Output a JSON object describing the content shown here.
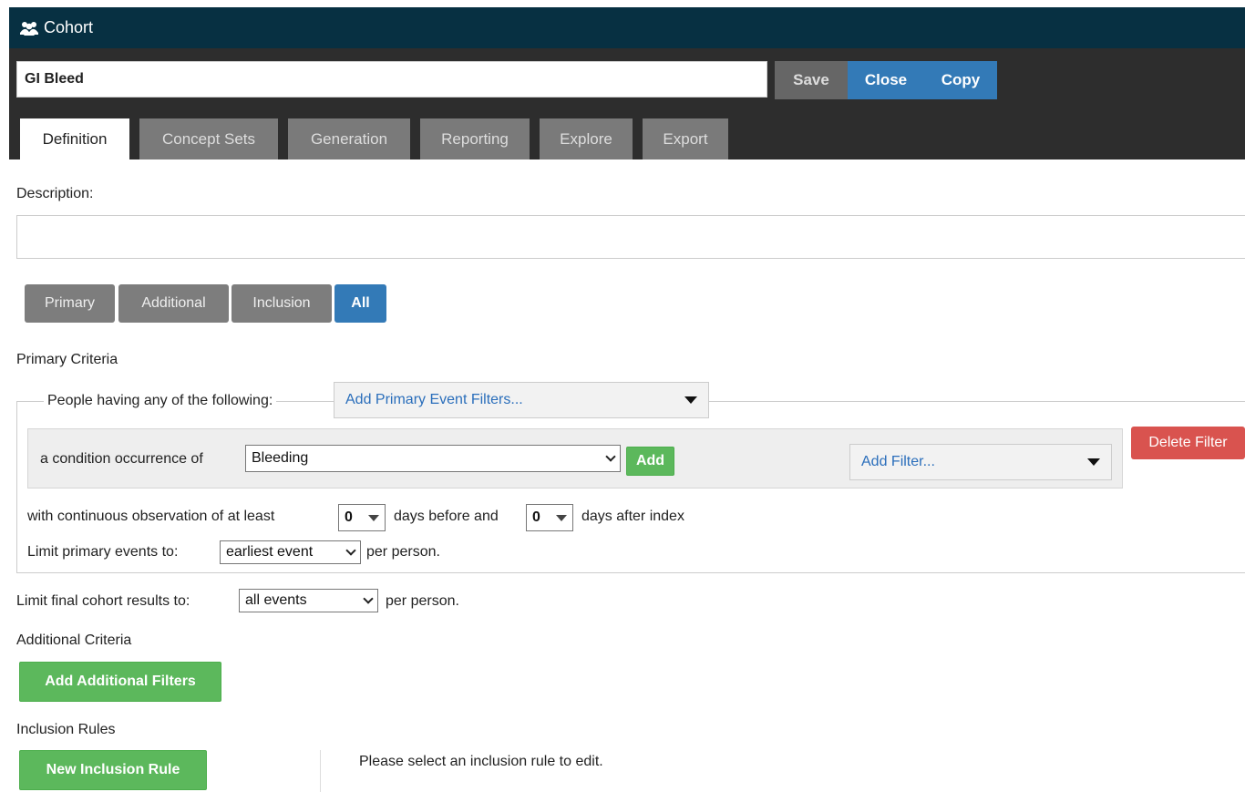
{
  "header": {
    "title": "Cohort",
    "icon": "users-icon",
    "cohort_name": "GI Bleed",
    "save_label": "Save",
    "close_label": "Close",
    "copy_label": "Copy"
  },
  "tabs": [
    "Definition",
    "Concept Sets",
    "Generation",
    "Reporting",
    "Explore",
    "Export"
  ],
  "active_tab": "Definition",
  "description": {
    "label": "Description:",
    "value": ""
  },
  "view_toggle": {
    "items": [
      "Primary",
      "Additional",
      "Inclusion",
      "All"
    ],
    "selected": "All"
  },
  "primary_criteria": {
    "title": "Primary Criteria",
    "legend_text": "People having any of the following:",
    "add_filters_label": "Add Primary Event Filters...",
    "condition": {
      "prefix": "a condition occurrence of",
      "concept_set": "Bleeding",
      "add_label": "Add",
      "add_filter_label": "Add Filter...",
      "delete_label": "Delete Filter"
    },
    "observation": {
      "prefix": "with continuous observation of at least",
      "days_before": "0",
      "middle": "days before and",
      "days_after": "0",
      "suffix": "days after index"
    },
    "limit": {
      "prefix": "Limit primary events to:",
      "value": "earliest event",
      "suffix": "per person."
    }
  },
  "final_limit": {
    "prefix": "Limit final cohort results to:",
    "value": "all events",
    "suffix": "per person."
  },
  "additional_criteria": {
    "title": "Additional Criteria",
    "button_label": "Add Additional Filters"
  },
  "inclusion_rules": {
    "title": "Inclusion Rules",
    "button_label": "New Inclusion Rule",
    "placeholder": "Please select an inclusion rule to edit."
  },
  "colors": {
    "header_bg": "#073042",
    "toolbar_bg": "#2d2d2d",
    "primary": "#337ab7",
    "success": "#5cb85c",
    "danger": "#d9534f"
  }
}
